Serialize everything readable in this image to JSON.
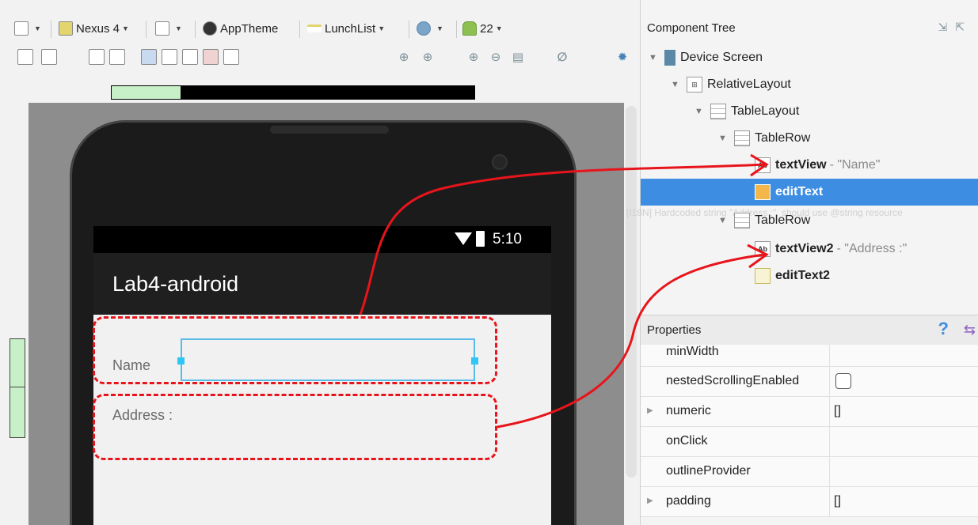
{
  "toolbar": {
    "device": "Nexus 4",
    "theme": "AppTheme",
    "activity": "LunchList",
    "api_level": "22"
  },
  "progress": {
    "fraction": 0.19
  },
  "phone": {
    "clock": "5:10",
    "app_title": "Lab4-android",
    "labels": {
      "name": "Name",
      "address": "Address :"
    }
  },
  "component_tree": {
    "title": "Component Tree",
    "nodes": [
      {
        "label": "Device Screen",
        "hint": ""
      },
      {
        "label": "RelativeLayout",
        "hint": ""
      },
      {
        "label": "TableLayout",
        "hint": ""
      },
      {
        "label": "TableRow",
        "hint": ""
      },
      {
        "label": "textView",
        "hint": "- \"Name\""
      },
      {
        "label": "editText",
        "hint": ""
      },
      {
        "label": "TableRow",
        "hint": ""
      },
      {
        "label": "textView2",
        "hint": "- \"Address :\""
      },
      {
        "label": "editText2",
        "hint": ""
      }
    ],
    "lint_warning": "[I18N] Hardcoded string \"Address :\", should use @string resource"
  },
  "properties": {
    "title": "Properties",
    "rows": [
      {
        "name": "minWidth",
        "value": ""
      },
      {
        "name": "nestedScrollingEnabled",
        "value": ""
      },
      {
        "name": "numeric",
        "value": "[]"
      },
      {
        "name": "onClick",
        "value": ""
      },
      {
        "name": "outlineProvider",
        "value": ""
      },
      {
        "name": "padding",
        "value": "[]"
      }
    ]
  },
  "colors": {
    "highlight_red": "#e8141b",
    "selection_blue": "#3d8ee2"
  }
}
